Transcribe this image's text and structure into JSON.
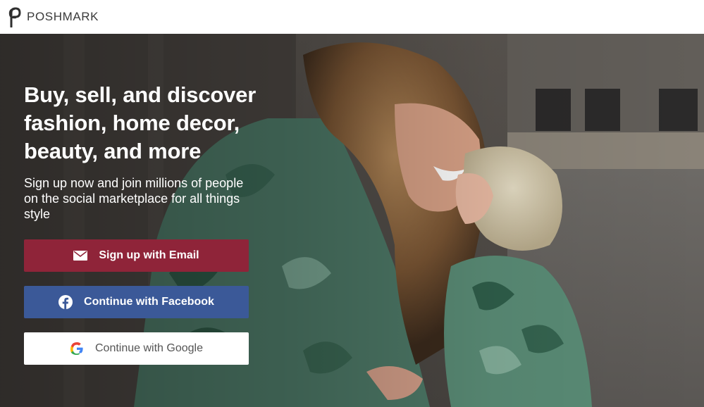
{
  "header": {
    "brand": "POSHMARK",
    "logo_icon": "poshmark-logo-icon"
  },
  "hero": {
    "headline": "Buy, sell, and discover\nfashion, home decor,\nbeauty, and more",
    "subtext": "Sign up now and join millions of people on the social marketplace for all things style",
    "background_image": "mother-and-child-photo"
  },
  "buttons": {
    "email": {
      "label": "Sign up with Email",
      "icon": "envelope-icon",
      "color": "#8f2439"
    },
    "facebook": {
      "label": "Continue with Facebook",
      "icon": "facebook-icon",
      "color": "#3b5998"
    },
    "google": {
      "label": "Continue with Google",
      "icon": "google-icon",
      "color": "#ffffff"
    }
  },
  "colors": {
    "brand": "#7f0353",
    "email_button": "#8f2439",
    "facebook_button": "#3b5998",
    "google_button": "#ffffff"
  }
}
